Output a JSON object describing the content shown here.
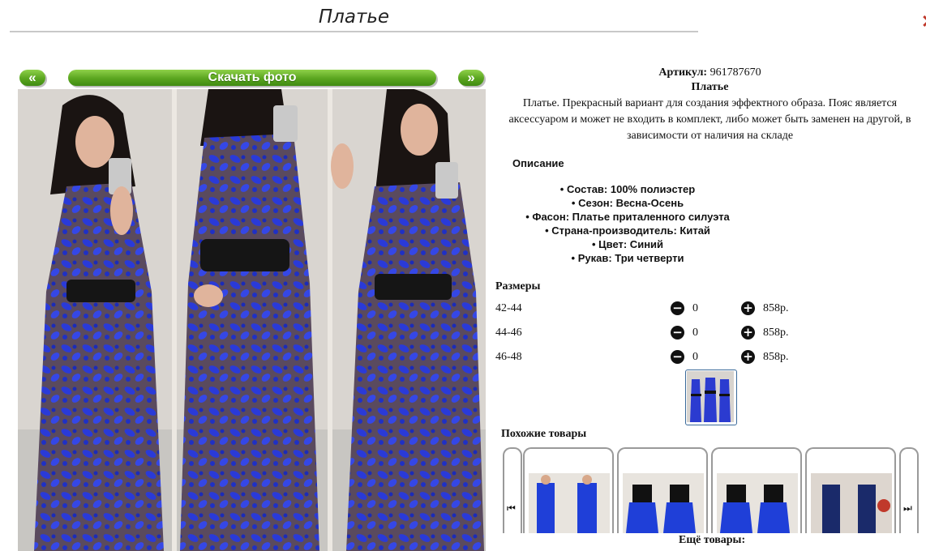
{
  "page": {
    "title": "Платье",
    "close_icon": "close-icon"
  },
  "gallery": {
    "prev_label": "«",
    "next_label": "»",
    "download_label": "Скачать фото"
  },
  "product": {
    "article_label": "Артикул:",
    "article_value": "961787670",
    "name": "Платье",
    "description": "Платье. Прекрасный вариант для создания эффектного образа. Пояс является аксессуаром и может не входить в комплект, либо может быть заменен на другой, в зависимости от наличия на складе",
    "specs_heading": "Описание",
    "specs": [
      "Состав: 100% полиэстер",
      "Сезон: Весна-Осень",
      "Фасон: Платье приталенного силуэта",
      "Страна-производитель: Китай",
      "Цвет: Синий",
      "Рукав: Три четверти"
    ]
  },
  "sizes": {
    "heading": "Размеры",
    "rows": [
      {
        "label": "42-44",
        "qty": "0",
        "price": "858р."
      },
      {
        "label": "44-46",
        "qty": "0",
        "price": "858р."
      },
      {
        "label": "46-48",
        "qty": "0",
        "price": "858р."
      }
    ]
  },
  "similar": {
    "heading": "Похожие товары",
    "more_label": "Ещё товары:",
    "prev_icon": "skip-back-icon",
    "next_icon": "skip-forward-icon"
  },
  "colors": {
    "accent_green": "#5aa51f",
    "dress_blue": "#2233cc",
    "close_red": "#c0392b"
  }
}
